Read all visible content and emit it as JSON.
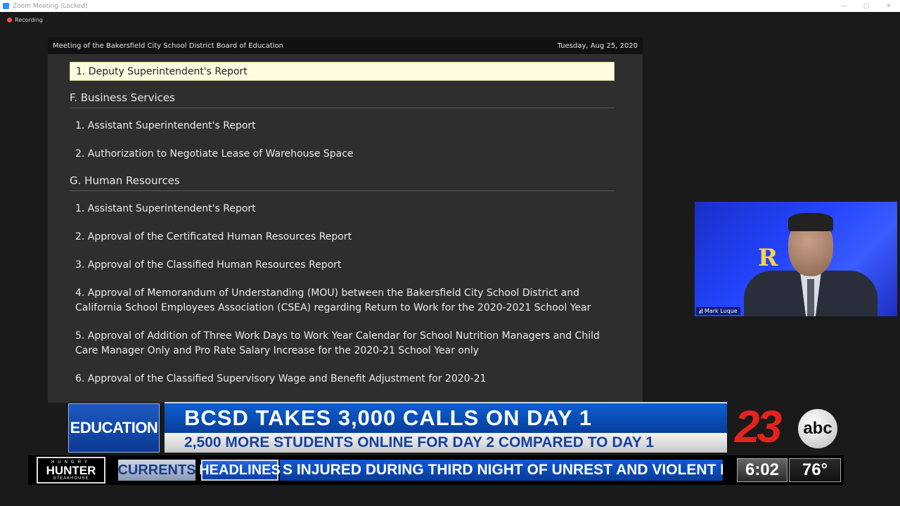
{
  "window": {
    "title": "Zoom Meeting (Locked)",
    "recording_label": "Recording",
    "controls": [
      "—",
      "▢",
      "✕"
    ]
  },
  "document": {
    "header_left": "Meeting of the Bakersfield City School District Board of Education",
    "header_right": "Tuesday, Aug 25, 2020",
    "highlighted_item": "1. Deputy Superintendent's Report",
    "sections": [
      {
        "title": "F. Business Services",
        "items": [
          [
            "1. Assistant Superintendent's Report"
          ],
          [
            "2. Authorization to Negotiate Lease of Warehouse Space"
          ]
        ]
      },
      {
        "title": "G. Human Resources",
        "items": [
          [
            "1. Assistant Superintendent's Report"
          ],
          [
            "2. Approval of the Certificated Human Resources Report"
          ],
          [
            "3. Approval of the Classified Human Resources Report"
          ],
          [
            "4. Approval of Memorandum of Understanding (MOU) between the Bakersfield City School District and",
            "California School Employees Association (CSEA) regarding Return to Work for the 2020-2021 School Year"
          ],
          [
            "5. Approval of Addition of Three Work Days to Work Year Calendar for School Nutrition Managers and Child",
            "Care Manager Only and Pro Rate Salary Increase for the 2020-21 School Year only"
          ],
          [
            "6. Approval of the Classified Supervisory Wage and Benefit Adjustment for 2020-21"
          ]
        ]
      }
    ]
  },
  "video": {
    "participant_name": "Mark Luque",
    "logo_letter": "R"
  },
  "broadcast": {
    "category": "EDUCATION",
    "headline": "BCSD TAKES 3,000 CALLS ON DAY 1",
    "subheadline": "2,500 MORE STUDENTS ONLINE FOR DAY 2 COMPARED TO DAY 1",
    "station_number": "23",
    "network": "abc",
    "sponsor": {
      "line1": "HUNGRY",
      "line2": "HUNTER",
      "line3": "STEAKHOUSE"
    },
    "ticker_tab1": "CURRENTS",
    "ticker_tab2": "HEADLINES",
    "ticker_text": "S INJURED DURING THIRD NIGHT OF UNREST AND VIOLENT PRO",
    "time": "6:02",
    "temperature": "76°"
  }
}
